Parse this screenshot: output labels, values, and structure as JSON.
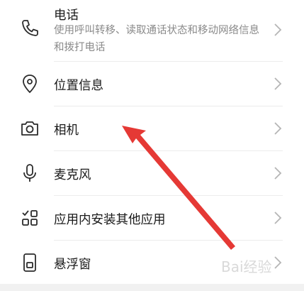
{
  "permissions": [
    {
      "title": "电话",
      "subtitle": "使用呼叫转移、读取通话状态和移动网络信息和拨打电话",
      "icon": "phone-icon"
    },
    {
      "title": "位置信息",
      "icon": "location-pin-icon"
    },
    {
      "title": "相机",
      "icon": "camera-icon"
    },
    {
      "title": "麦克风",
      "icon": "microphone-icon"
    },
    {
      "title": "应用内安装其他应用",
      "icon": "app-grid-icon"
    },
    {
      "title": "悬浮窗",
      "icon": "floating-window-icon"
    }
  ],
  "annotation": {
    "arrow_color": "#e53935"
  },
  "watermark": {
    "text": "Bai经验"
  }
}
